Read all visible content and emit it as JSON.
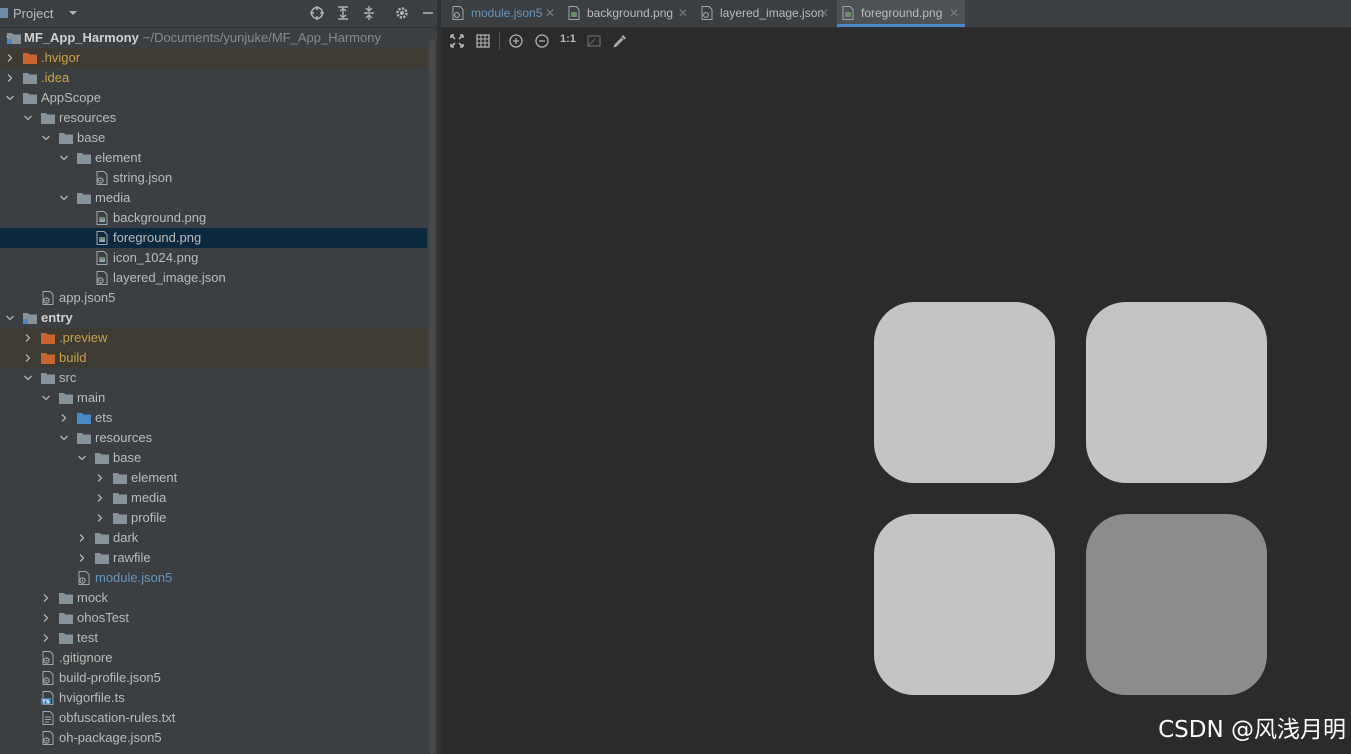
{
  "project": {
    "title": "Project",
    "root_name": "MF_App_Harmony",
    "root_path": "~/Documents/yunjuke/MF_App_Harmony"
  },
  "tree": [
    {
      "label": ".hvigor",
      "kind": "folder-excl",
      "expand": "collapsed",
      "style": "orange",
      "highlight": "excl"
    },
    {
      "label": ".idea",
      "kind": "folder",
      "expand": "collapsed",
      "style": "orange"
    },
    {
      "label": "AppScope",
      "kind": "folder",
      "expand": "expanded"
    },
    {
      "label": "resources",
      "kind": "folder",
      "expand": "expanded"
    },
    {
      "label": "base",
      "kind": "folder",
      "expand": "expanded"
    },
    {
      "label": "element",
      "kind": "folder",
      "expand": "expanded"
    },
    {
      "label": "string.json",
      "kind": "json-file"
    },
    {
      "label": "media",
      "kind": "folder",
      "expand": "expanded"
    },
    {
      "label": "background.png",
      "kind": "image-file"
    },
    {
      "label": "foreground.png",
      "kind": "image-file",
      "highlight": "sel"
    },
    {
      "label": "icon_1024.png",
      "kind": "image-file"
    },
    {
      "label": "layered_image.json",
      "kind": "json-file"
    },
    {
      "label": "app.json5",
      "kind": "json-file"
    },
    {
      "label": "entry",
      "kind": "module-folder",
      "expand": "expanded",
      "style": "bold"
    },
    {
      "label": ".preview",
      "kind": "folder-excl",
      "expand": "collapsed",
      "style": "orange",
      "highlight": "excl"
    },
    {
      "label": "build",
      "kind": "folder-excl",
      "expand": "collapsed",
      "style": "orange",
      "highlight": "excl"
    },
    {
      "label": "src",
      "kind": "folder",
      "expand": "expanded"
    },
    {
      "label": "main",
      "kind": "folder",
      "expand": "expanded"
    },
    {
      "label": "ets",
      "kind": "folder-blue",
      "expand": "collapsed"
    },
    {
      "label": "resources",
      "kind": "folder",
      "expand": "expanded"
    },
    {
      "label": "base",
      "kind": "folder",
      "expand": "expanded"
    },
    {
      "label": "element",
      "kind": "folder",
      "expand": "collapsed"
    },
    {
      "label": "media",
      "kind": "folder",
      "expand": "collapsed"
    },
    {
      "label": "profile",
      "kind": "folder",
      "expand": "collapsed"
    },
    {
      "label": "dark",
      "kind": "folder",
      "expand": "collapsed"
    },
    {
      "label": "rawfile",
      "kind": "folder",
      "expand": "collapsed"
    },
    {
      "label": "module.json5",
      "kind": "json-file",
      "style": "blue"
    },
    {
      "label": "mock",
      "kind": "folder",
      "expand": "collapsed"
    },
    {
      "label": "ohosTest",
      "kind": "folder",
      "expand": "collapsed"
    },
    {
      "label": "test",
      "kind": "folder",
      "expand": "collapsed"
    },
    {
      "label": ".gitignore",
      "kind": "json-file"
    },
    {
      "label": "build-profile.json5",
      "kind": "json-file"
    },
    {
      "label": "hvigorfile.ts",
      "kind": "ts-file"
    },
    {
      "label": "obfuscation-rules.txt",
      "kind": "text-file"
    },
    {
      "label": "oh-package.json5",
      "kind": "json-file"
    }
  ],
  "tabs": [
    {
      "label": "module.json5",
      "icon": "json-file",
      "style": "blue"
    },
    {
      "label": "background.png",
      "icon": "image-file"
    },
    {
      "label": "layered_image.json",
      "icon": "json-file"
    },
    {
      "label": "foreground.png",
      "icon": "image-file",
      "active": true
    }
  ],
  "image_toolbar": {
    "actual_size_label": "1:1"
  },
  "tiles": [
    {
      "color": "#c4c4c4"
    },
    {
      "color": "#c4c4c4"
    },
    {
      "color": "#c4c4c4"
    },
    {
      "color": "#8c8c8c"
    }
  ],
  "watermark": "CSDN @风浅月明"
}
